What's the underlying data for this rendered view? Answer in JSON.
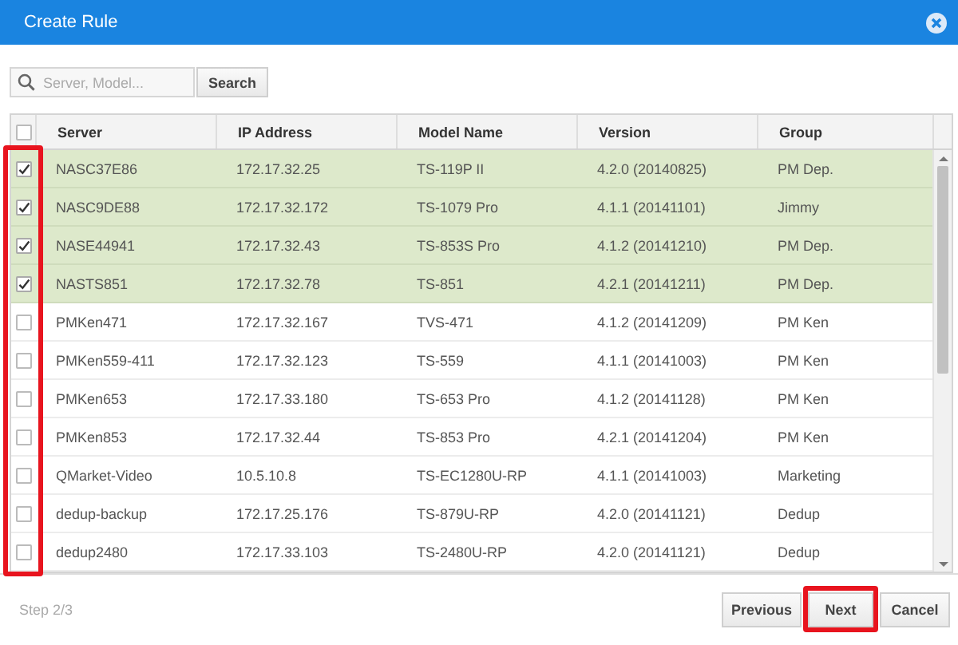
{
  "window": {
    "title": "Create Rule"
  },
  "search": {
    "placeholder": "Server, Model...",
    "button": "Search"
  },
  "table": {
    "all_checked": false,
    "columns": [
      "Server",
      "IP Address",
      "Model Name",
      "Version",
      "Group"
    ],
    "rows": [
      {
        "checked": true,
        "cells": [
          "NASC37E86",
          "172.17.32.25",
          "TS-119P II",
          "4.2.0 (20140825)",
          "PM Dep."
        ]
      },
      {
        "checked": true,
        "cells": [
          "NASC9DE88",
          "172.17.32.172",
          "TS-1079 Pro",
          "4.1.1 (20141101)",
          "Jimmy"
        ]
      },
      {
        "checked": true,
        "cells": [
          "NASE44941",
          "172.17.32.43",
          "TS-853S Pro",
          "4.1.2 (20141210)",
          "PM Dep."
        ]
      },
      {
        "checked": true,
        "cells": [
          "NASTS851",
          "172.17.32.78",
          "TS-851",
          "4.2.1 (20141211)",
          "PM Dep."
        ]
      },
      {
        "checked": false,
        "cells": [
          "PMKen471",
          "172.17.32.167",
          "TVS-471",
          "4.1.2 (20141209)",
          "PM Ken"
        ]
      },
      {
        "checked": false,
        "cells": [
          "PMKen559-411",
          "172.17.32.123",
          "TS-559",
          "4.1.1 (20141003)",
          "PM Ken"
        ]
      },
      {
        "checked": false,
        "cells": [
          "PMKen653",
          "172.17.33.180",
          "TS-653 Pro",
          "4.1.2 (20141128)",
          "PM Ken"
        ]
      },
      {
        "checked": false,
        "cells": [
          "PMKen853",
          "172.17.32.44",
          "TS-853 Pro",
          "4.2.1 (20141204)",
          "PM Ken"
        ]
      },
      {
        "checked": false,
        "cells": [
          "QMarket-Video",
          "10.5.10.8",
          "TS-EC1280U-RP",
          "4.1.1 (20141003)",
          "Marketing"
        ]
      },
      {
        "checked": false,
        "cells": [
          "dedup-backup",
          "172.17.25.176",
          "TS-879U-RP",
          "4.2.0 (20141121)",
          "Dedup"
        ]
      },
      {
        "checked": false,
        "cells": [
          "dedup2480",
          "172.17.33.103",
          "TS-2480U-RP",
          "4.2.0 (20141121)",
          "Dedup"
        ]
      }
    ]
  },
  "footer": {
    "step": "Step 2/3",
    "buttons": [
      "Previous",
      "Next",
      "Cancel"
    ]
  }
}
